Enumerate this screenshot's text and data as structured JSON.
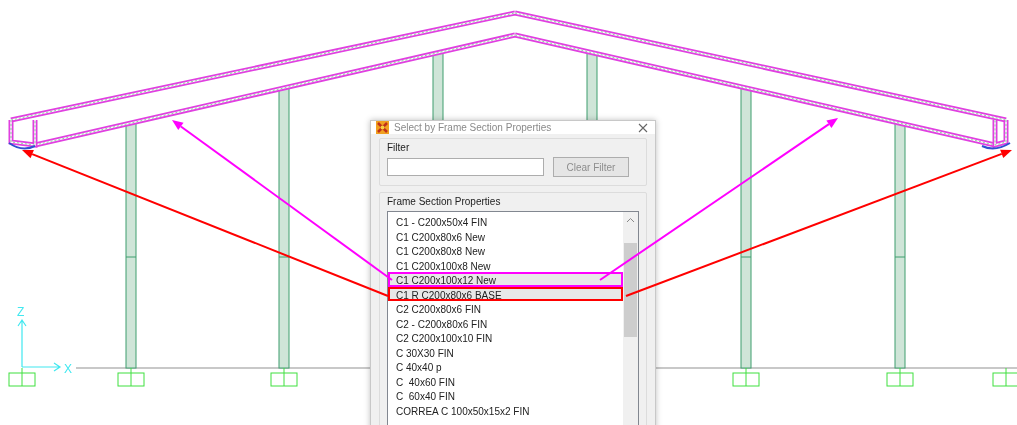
{
  "window": {
    "title": "Select by Frame Section Properties"
  },
  "filter": {
    "label": "Filter",
    "clear_button": {
      "label": "Clear Filter",
      "disabled": true
    }
  },
  "section_list": {
    "label": "Frame Section Properties",
    "items": [
      {
        "label": "C1 - C200x50x4 FIN",
        "selected": false
      },
      {
        "label": "C1 C200x80x6 New",
        "selected": false
      },
      {
        "label": "C1 C200x80x8 New",
        "selected": false
      },
      {
        "label": "C1 C200x100x8 New",
        "selected": false
      },
      {
        "label": "C1 C200x100x12 New",
        "selected": true,
        "color": "#ff00ff"
      },
      {
        "label": "C1 R C200x80x6 BASE",
        "selected": true,
        "color": "#ff0000"
      },
      {
        "label": "C2 C200x80x6 FIN",
        "selected": false
      },
      {
        "label": "C2 - C200x80x6 FIN",
        "selected": false
      },
      {
        "label": "C2 C200x100x10 FIN",
        "selected": false
      },
      {
        "label": "C 30X30 FIN",
        "selected": false
      },
      {
        "label": "C 40x40 p",
        "selected": false
      },
      {
        "label": "C  40x60 FIN",
        "selected": false
      },
      {
        "label": "C  60x40 FIN",
        "selected": false
      },
      {
        "label": "CORREA C 100x50x15x2 FIN",
        "selected": false
      }
    ]
  },
  "axes": {
    "vertical": "Z",
    "horizontal": "X"
  }
}
